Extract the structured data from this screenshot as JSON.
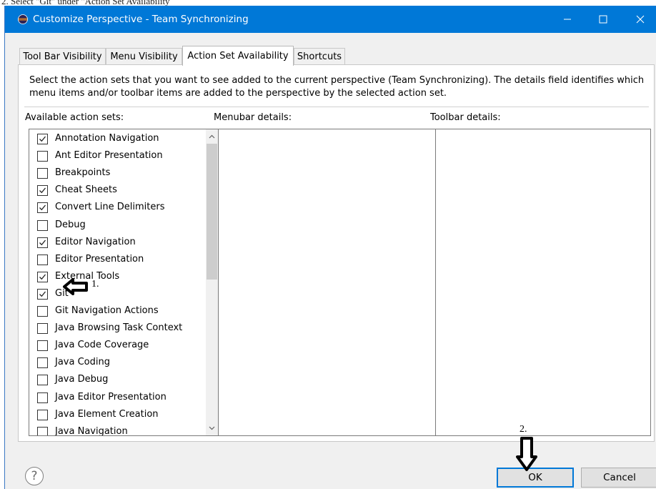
{
  "caption": "2. Select \"Git\" under \"Action Set Availability",
  "window": {
    "title": "Customize Perspective - Team Synchronizing",
    "controls": [
      "minimize",
      "maximize",
      "close"
    ]
  },
  "tabs": [
    {
      "label": "Tool Bar Visibility",
      "active": false
    },
    {
      "label": "Menu Visibility",
      "active": false
    },
    {
      "label": "Action Set Availability",
      "active": true
    },
    {
      "label": "Shortcuts",
      "active": false
    }
  ],
  "description": "Select the action sets that you want to see added to the current perspective (Team Synchronizing).  The details field identifies which menu items and/or toolbar items are added to the perspective by the selected action set.",
  "labels": {
    "available": "Available action sets:",
    "menubar": "Menubar details:",
    "toolbar": "Toolbar details:"
  },
  "action_sets": [
    {
      "label": "Annotation Navigation",
      "checked": true
    },
    {
      "label": "Ant Editor Presentation",
      "checked": false
    },
    {
      "label": "Breakpoints",
      "checked": false
    },
    {
      "label": "Cheat Sheets",
      "checked": true
    },
    {
      "label": "Convert Line Delimiters",
      "checked": true
    },
    {
      "label": "Debug",
      "checked": false
    },
    {
      "label": "Editor Navigation",
      "checked": true
    },
    {
      "label": "Editor Presentation",
      "checked": false
    },
    {
      "label": "External Tools",
      "checked": true
    },
    {
      "label": "Git",
      "checked": true
    },
    {
      "label": "Git Navigation Actions",
      "checked": false
    },
    {
      "label": "Java Browsing Task Context",
      "checked": false
    },
    {
      "label": "Java Code Coverage",
      "checked": false
    },
    {
      "label": "Java Coding",
      "checked": false
    },
    {
      "label": "Java Debug",
      "checked": false
    },
    {
      "label": "Java Editor Presentation",
      "checked": false
    },
    {
      "label": "Java Element Creation",
      "checked": false
    },
    {
      "label": "Java Navigation",
      "checked": false
    }
  ],
  "annotations": {
    "step1": "1.",
    "step2": "2."
  },
  "buttons": {
    "help": "?",
    "ok": "OK",
    "cancel": "Cancel"
  },
  "colors": {
    "titlebar": "#0078d7",
    "focus_border": "#0078d7",
    "dialog_bg": "#f0f0f0"
  }
}
